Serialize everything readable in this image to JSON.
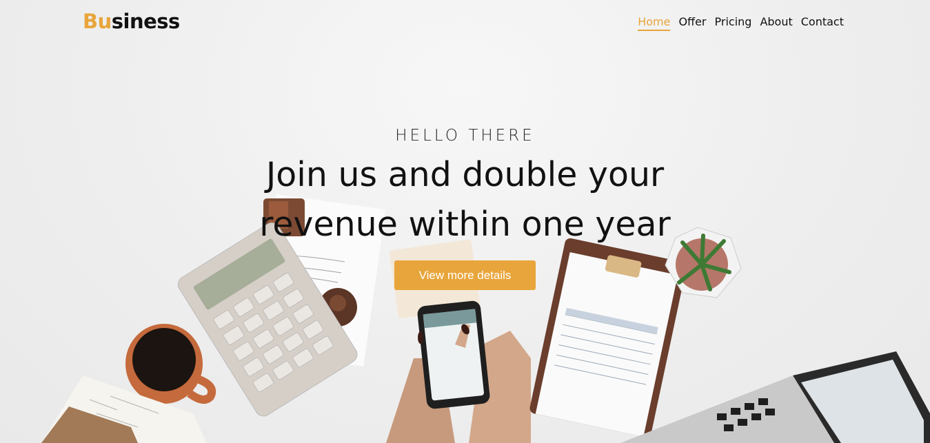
{
  "brand": {
    "accent_part": "Bu",
    "rest_part": "siness",
    "accent_color": "#e8a53b"
  },
  "nav": {
    "items": [
      {
        "label": "Home",
        "active": true
      },
      {
        "label": "Offer",
        "active": false
      },
      {
        "label": "Pricing",
        "active": false
      },
      {
        "label": "About",
        "active": false
      },
      {
        "label": "Contact",
        "active": false
      }
    ]
  },
  "hero": {
    "eyebrow": "HELLO THERE",
    "headline_line1": "Join us and double your",
    "headline_line2": "revenue within one year",
    "cta_label": "View more details",
    "background_image": "desk-workspace-photo"
  }
}
